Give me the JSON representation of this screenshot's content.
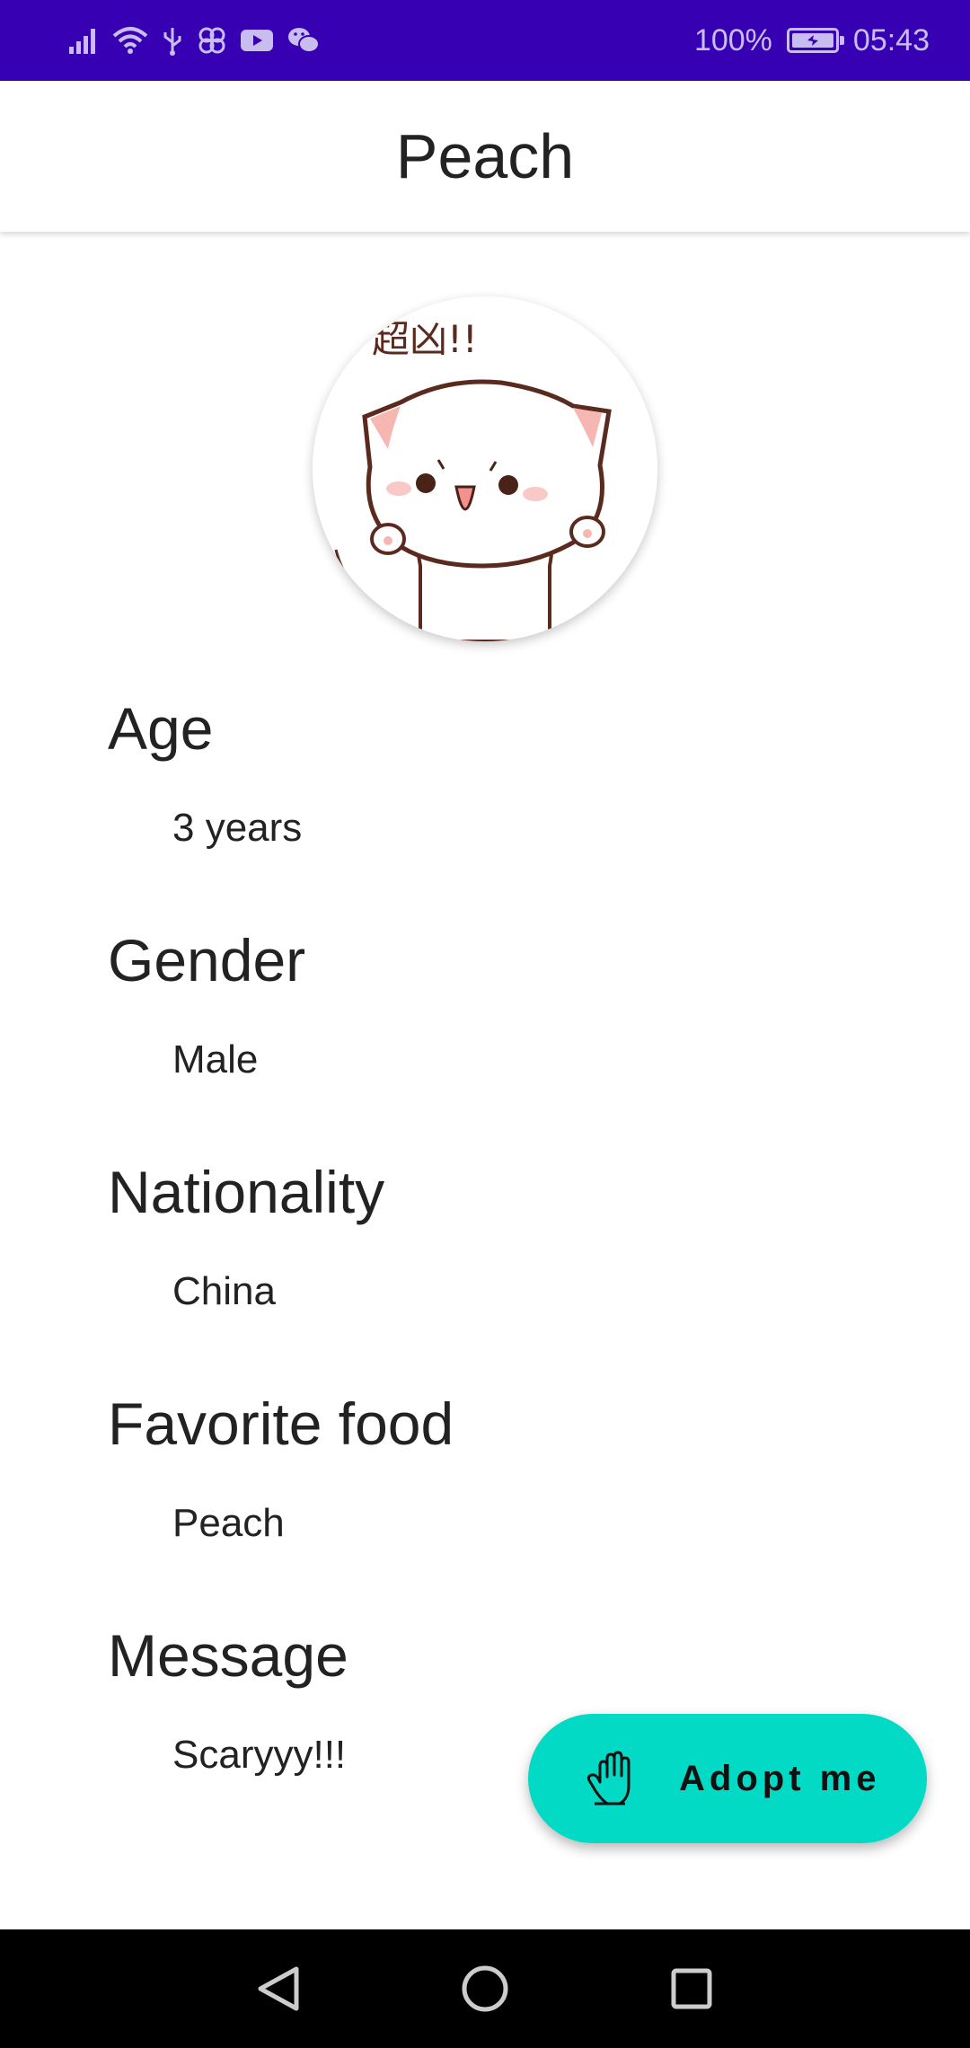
{
  "status_bar": {
    "battery": "100%",
    "time": "05:43",
    "icons": [
      "signal-icon",
      "wifi-icon",
      "usb-icon",
      "fan-icon",
      "youtube-icon",
      "wechat-icon"
    ]
  },
  "app_bar": {
    "title": "Peach"
  },
  "avatar": {
    "image": "cat-sticker",
    "caption": "超凶!!"
  },
  "fields": [
    {
      "label": "Age",
      "value": "3 years"
    },
    {
      "label": "Gender",
      "value": "Male"
    },
    {
      "label": "Nationality",
      "value": "China"
    },
    {
      "label": "Favorite food",
      "value": "Peach"
    },
    {
      "label": "Message",
      "value": "Scaryyy!!!"
    }
  ],
  "fab": {
    "label": "Adopt me",
    "icon": "hand-icon",
    "color": "#03dac5"
  },
  "nav": {
    "back": "back-icon",
    "home": "home-icon",
    "recents": "recents-icon"
  },
  "colors": {
    "status_bar": "#3700b3",
    "nav_bar": "#000000",
    "accent": "#03dac5"
  }
}
